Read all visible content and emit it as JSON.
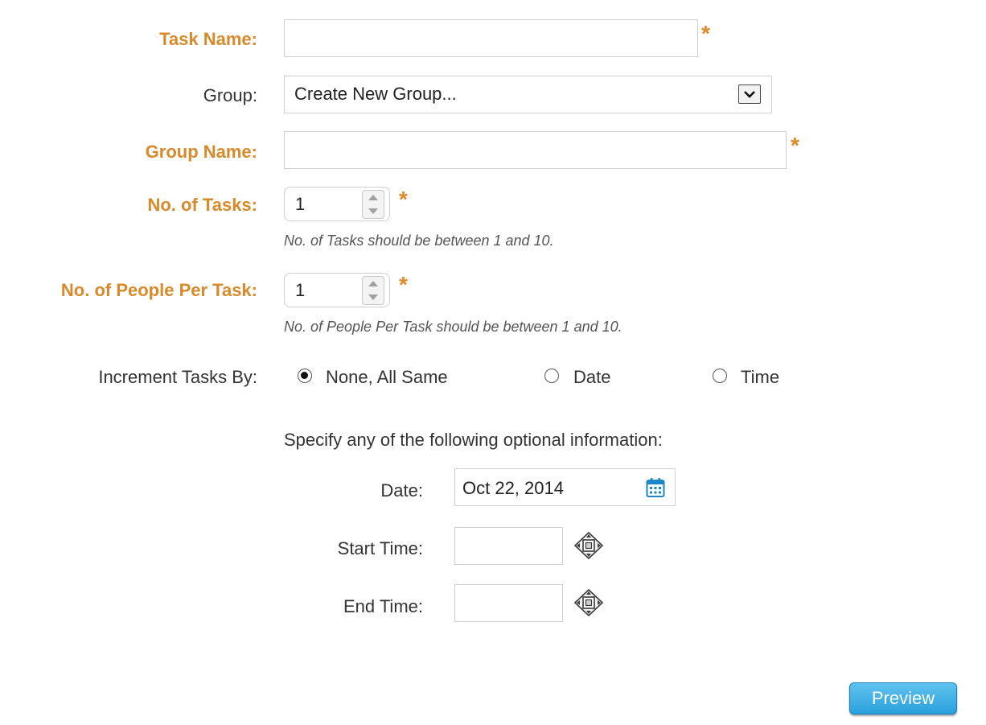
{
  "form": {
    "task_name": {
      "label": "Task Name:",
      "value": "",
      "required_mark": "*"
    },
    "group": {
      "label": "Group:",
      "selected": "Create New Group..."
    },
    "group_name": {
      "label": "Group Name:",
      "value": "",
      "required_mark": "*"
    },
    "num_tasks": {
      "label": "No. of Tasks:",
      "value": "1",
      "required_mark": "*",
      "hint": "No. of Tasks should be between 1 and 10."
    },
    "people_per_task": {
      "label": "No. of People Per Task:",
      "value": "1",
      "required_mark": "*",
      "hint": "No. of People Per Task should be between 1 and 10."
    },
    "increment": {
      "label": "Increment Tasks By:",
      "options": [
        {
          "label": "None, All Same",
          "checked": true
        },
        {
          "label": "Date",
          "checked": false
        },
        {
          "label": "Time",
          "checked": false
        }
      ]
    },
    "optional_heading": "Specify any of the following optional information:",
    "date": {
      "label": "Date:",
      "value": "Oct 22, 2014"
    },
    "start_time": {
      "label": "Start Time:",
      "value": ""
    },
    "end_time": {
      "label": "End Time:",
      "value": ""
    },
    "preview_label": "Preview"
  },
  "colors": {
    "required_label": "#d88a2b",
    "required_star": "#e08a2a",
    "button": "#2a9fdc"
  },
  "icons": {
    "select_arrow": "chevron-down-icon",
    "spinner_up": "arrow-up-icon",
    "spinner_down": "arrow-down-icon",
    "calendar": "calendar-icon",
    "time_picker": "time-picker-icon"
  }
}
